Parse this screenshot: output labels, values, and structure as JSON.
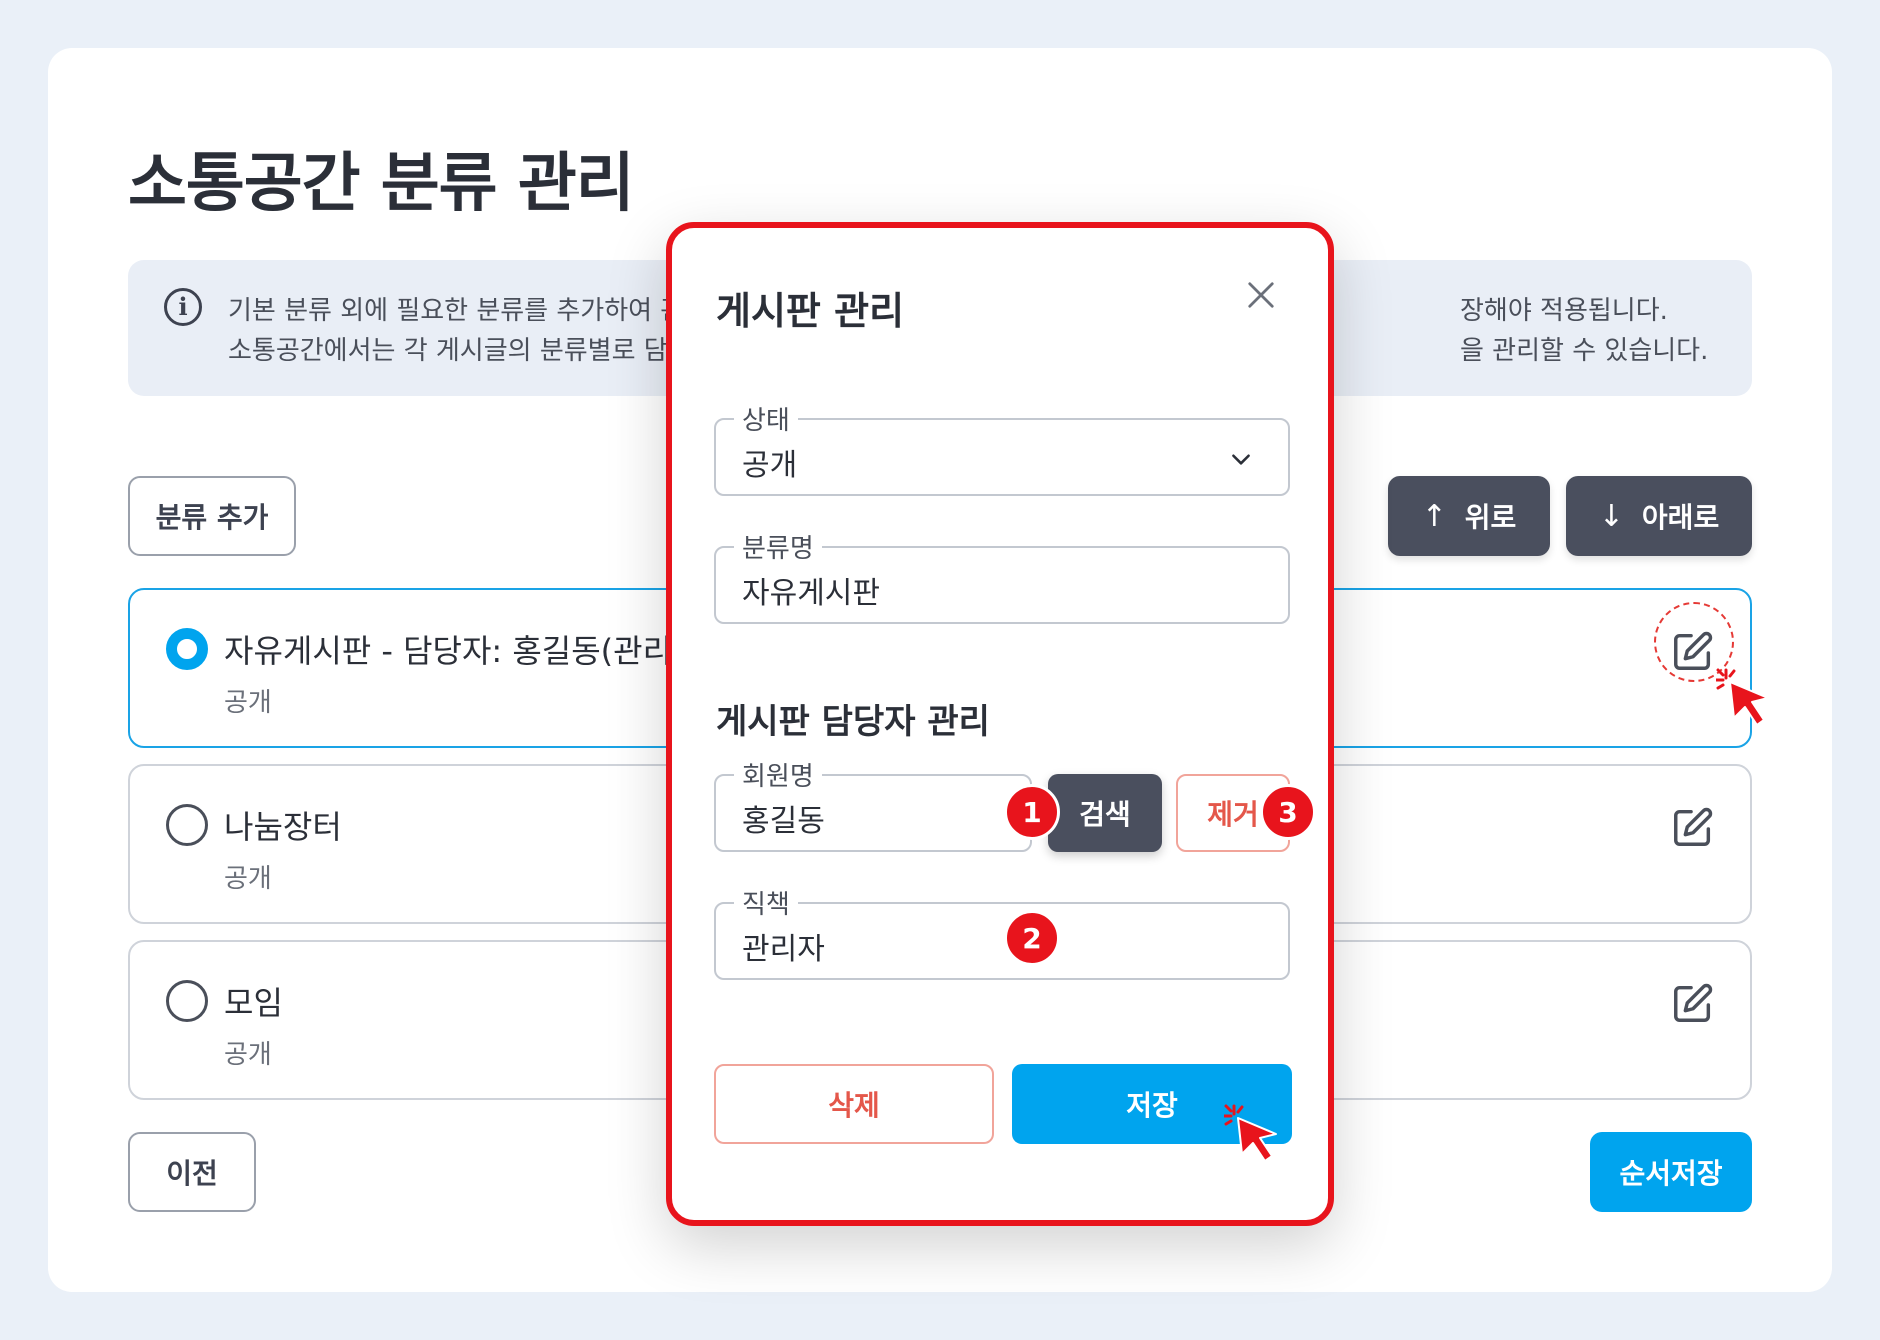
{
  "page": {
    "title": "소통공간 분류 관리",
    "info": {
      "line1_visible": "기본 분류 외에 필요한 분류를 추가하여 관",
      "line1_tail": "장해야 적용됩니다.",
      "line2_visible": "소통공간에서는 각 게시글의 분류별로 담",
      "line2_tail": "을 관리할 수 있습니다."
    }
  },
  "toolbar": {
    "add_category": "분류 추가",
    "move_up": "위로",
    "move_down": "아래로"
  },
  "categories": [
    {
      "name": "자유게시판  - 담당자: 홍길동(관리자",
      "status": "공개",
      "selected": true
    },
    {
      "name": "나눔장터",
      "status": "공개",
      "selected": false
    },
    {
      "name": "모임",
      "status": "공개",
      "selected": false
    }
  ],
  "footer": {
    "prev": "이전",
    "save_order": "순서저장"
  },
  "modal": {
    "title": "게시판 관리",
    "status_label": "상태",
    "status_value": "공개",
    "category_label": "분류명",
    "category_value": "자유게시판",
    "manager_section": "게시판 담당자 관리",
    "member_label": "회원명",
    "member_value": "홍길동",
    "search": "검색",
    "remove": "제거",
    "position_label": "직책",
    "position_value": "관리자",
    "delete": "삭제",
    "save": "저장"
  },
  "badges": [
    "1",
    "2",
    "3"
  ],
  "colors": {
    "accent": "#00a4ee",
    "dark_button": "#4a4f5e",
    "danger": "#e4574a",
    "highlight": "#e8141c"
  }
}
